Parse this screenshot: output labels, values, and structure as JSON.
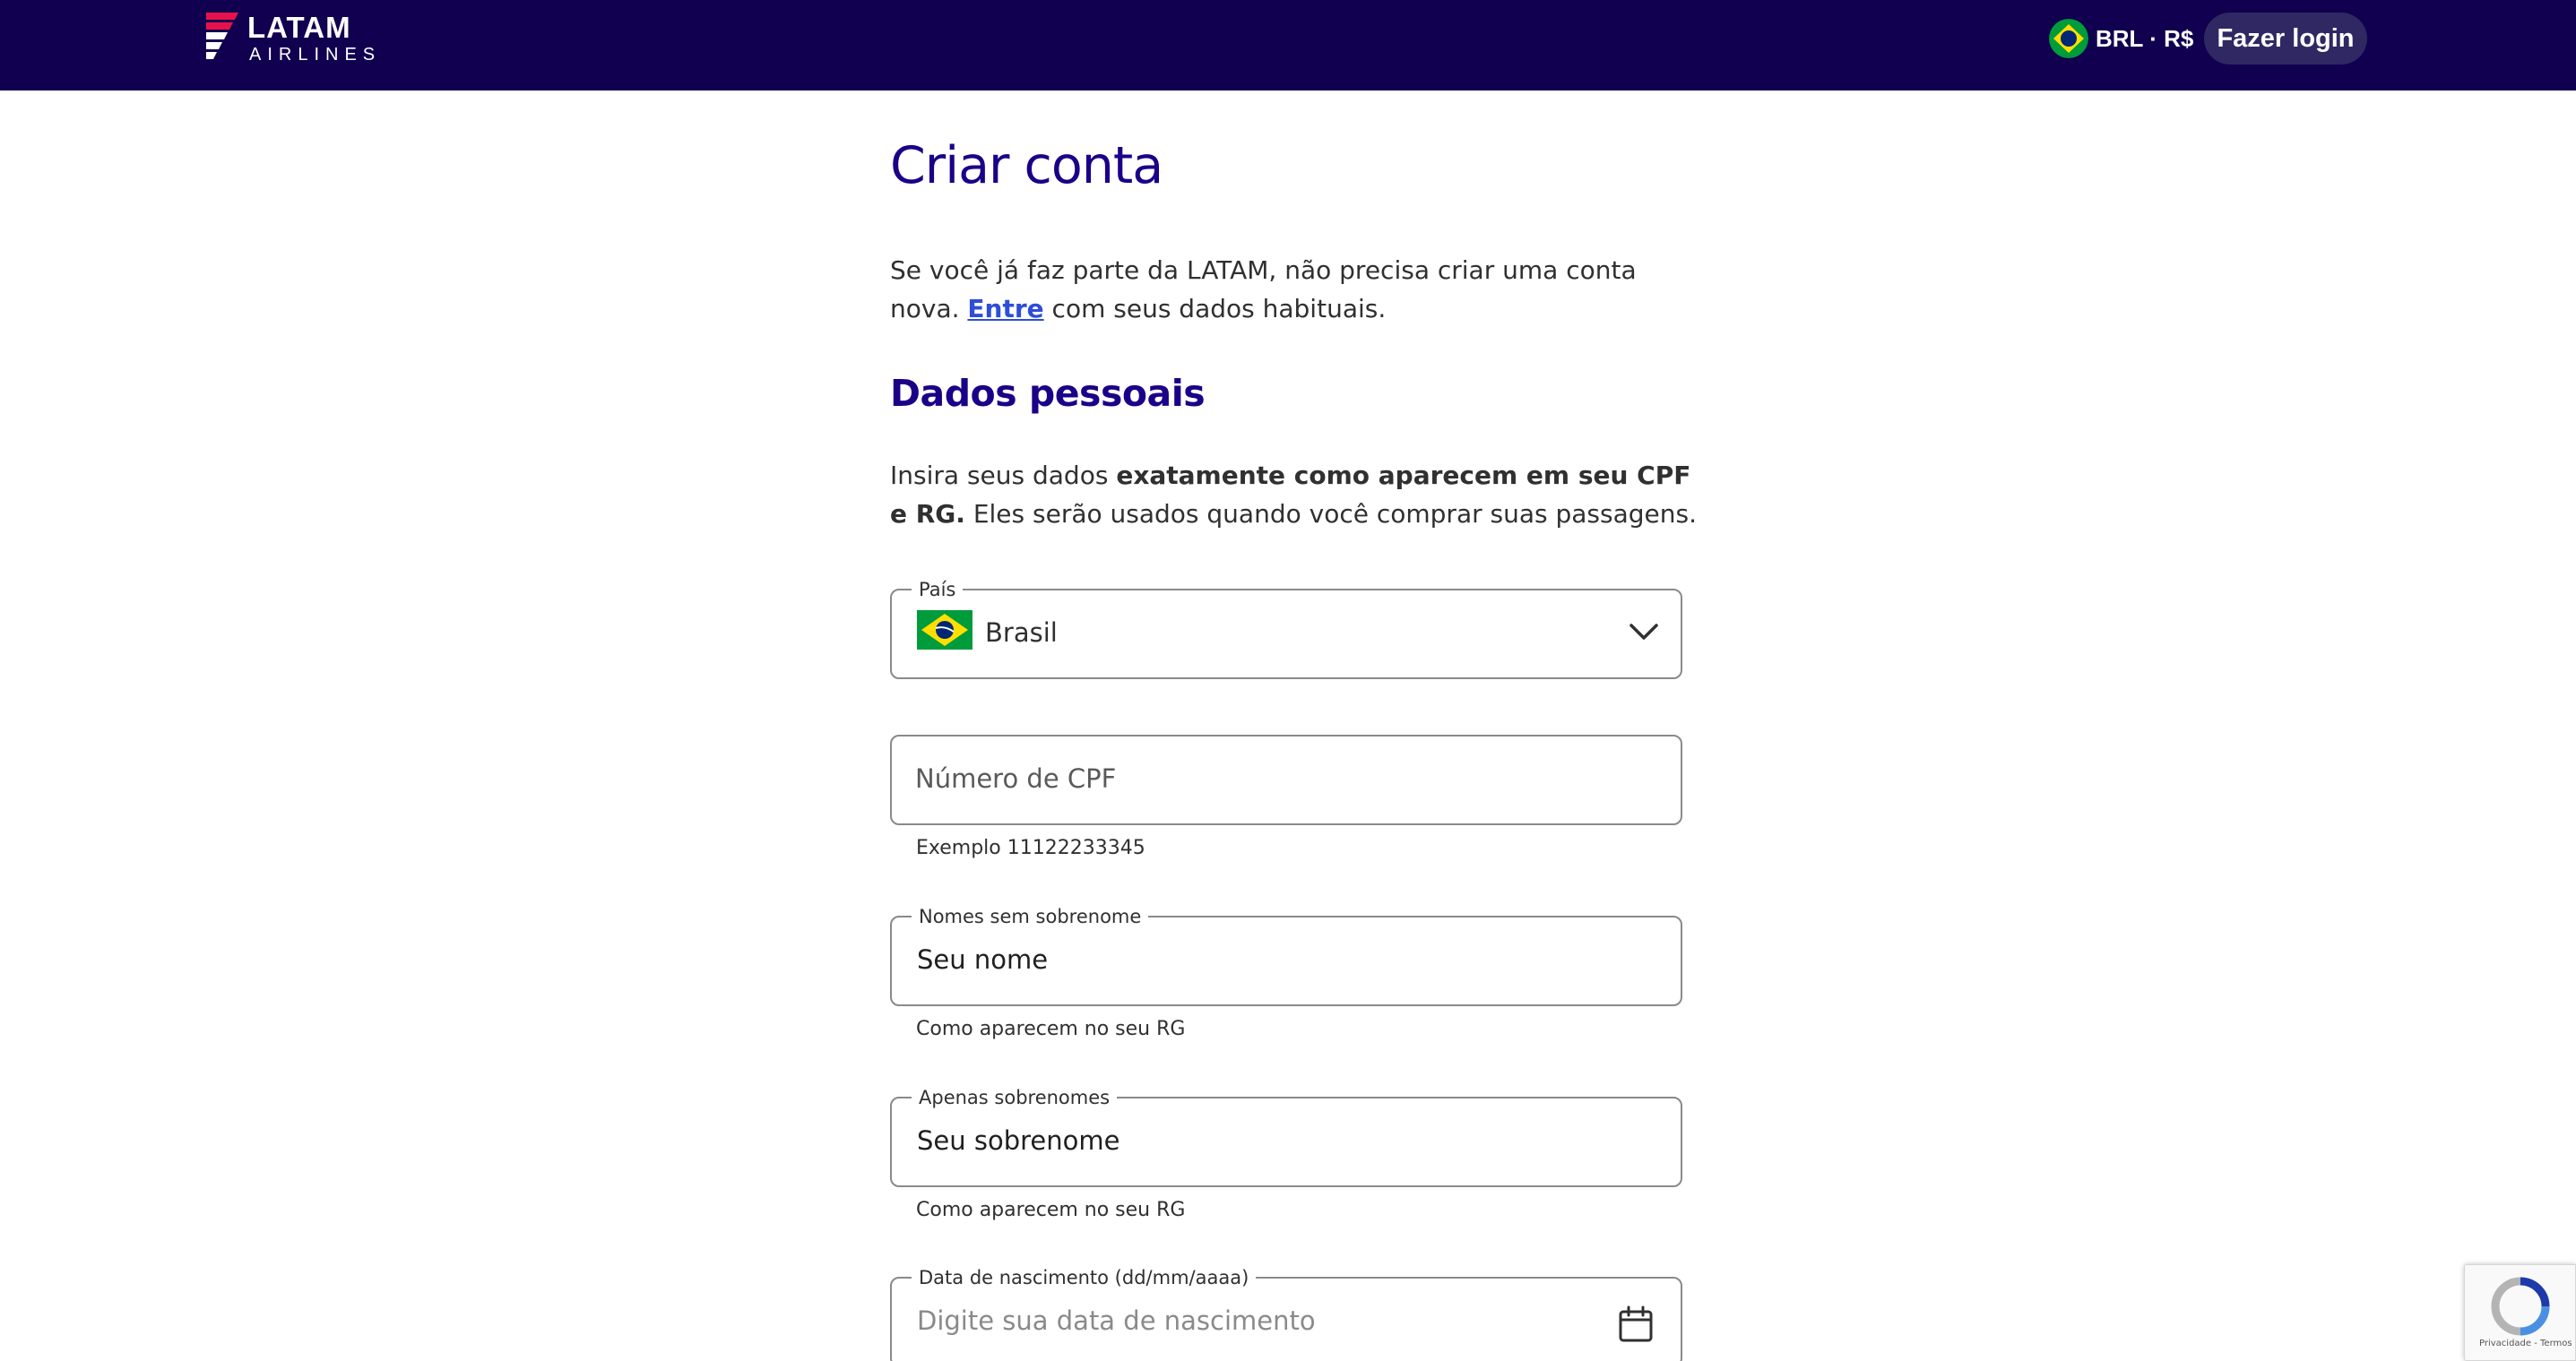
{
  "header": {
    "logo_word": "LATAM",
    "logo_sub": "AIRLINES",
    "currency": "BRL · R$",
    "login_label": "Fazer login",
    "background": "#10004f"
  },
  "page": {
    "title": "Criar conta",
    "intro_text": "Se você já faz parte da LATAM, não precisa criar uma conta nova. ",
    "intro_link": "Entre",
    "intro_text_after": " com seus dados habituais.",
    "section_title": "Dados pessoais",
    "desc_before": "Insira seus dados ",
    "desc_bold": "exatamente como aparecem em seu CPF e RG.",
    "desc_after": " Eles serão usados quando você comprar suas passagens."
  },
  "form": {
    "country": {
      "label": "País",
      "value": "Brasil",
      "icon": "brazil-flag-icon"
    },
    "cpf": {
      "placeholder": "Número de CPF",
      "helper": "Exemplo 11122233345"
    },
    "first_name": {
      "label": "Nomes sem sobrenome",
      "value": "Seu nome",
      "helper": "Como aparecem no seu RG"
    },
    "last_name": {
      "label": "Apenas sobrenomes",
      "value": "Seu sobrenome",
      "helper": "Como aparecem no seu RG"
    },
    "birth_date": {
      "label": "Data de nascimento (dd/mm/aaaa)",
      "placeholder": "Digite sua data de nascimento",
      "icon": "calendar-icon"
    }
  },
  "recaptcha": {
    "links": "Privacidade - Termos"
  },
  "colors": {
    "brand_navy": "#10004f",
    "title_blue": "#1b0088",
    "link_blue": "#2e4dd8",
    "login_button": "#302862"
  }
}
